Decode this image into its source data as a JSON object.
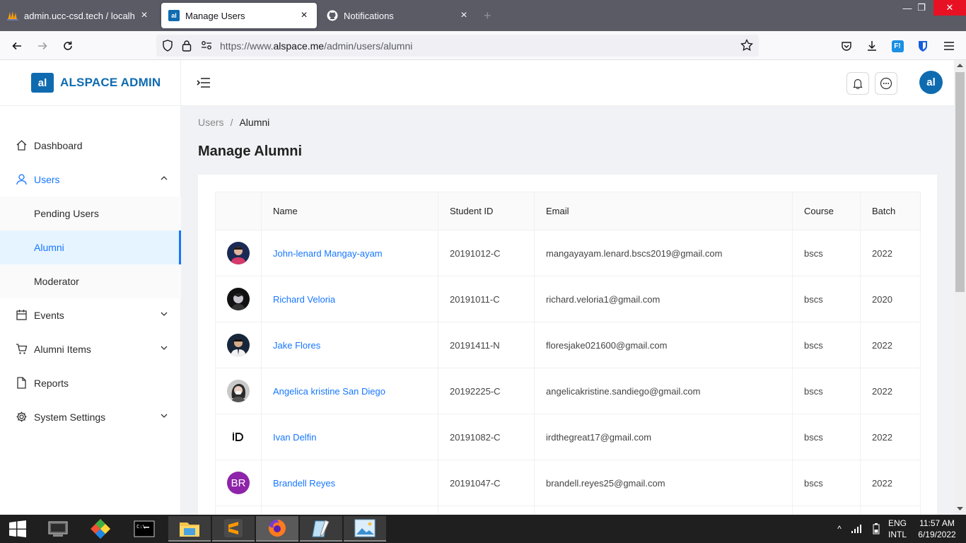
{
  "browser": {
    "tabs": [
      {
        "title": "admin.ucc-csd.tech / localhost",
        "active": false
      },
      {
        "title": "Manage Users",
        "active": true
      },
      {
        "title": "Notifications",
        "active": false
      }
    ],
    "url_prefix": "https://www.",
    "url_domain": "alspace.me",
    "url_path": "/admin/users/alumni"
  },
  "app": {
    "logo_text": "al",
    "brand": "ALSPACE ADMIN",
    "avatar_text": "al",
    "accent": "#1677ff",
    "brand_color": "#0f6bb0"
  },
  "sidebar": {
    "items": [
      {
        "label": "Dashboard",
        "icon": "home-icon"
      },
      {
        "label": "Users",
        "icon": "user-icon"
      },
      {
        "label": "Pending Users"
      },
      {
        "label": "Alumni"
      },
      {
        "label": "Moderator"
      },
      {
        "label": "Events",
        "icon": "calendar-icon"
      },
      {
        "label": "Alumni Items",
        "icon": "cart-icon"
      },
      {
        "label": "Reports",
        "icon": "file-icon"
      },
      {
        "label": "System Settings",
        "icon": "gear-icon"
      }
    ]
  },
  "breadcrumb": {
    "parent": "Users",
    "separator": "/",
    "current": "Alumni"
  },
  "page_title": "Manage Alumni",
  "table": {
    "headers": [
      "",
      "Name",
      "Student ID",
      "Email",
      "Course",
      "Batch"
    ],
    "rows": [
      {
        "name": "John-lenard Mangay-ayam",
        "student_id": "20191012-C",
        "email": "mangayayam.lenard.bscs2019@gmail.com",
        "course": "bscs",
        "batch": "2022"
      },
      {
        "name": "Richard Veloria",
        "student_id": "20191011-C",
        "email": "richard.veloria1@gmail.com",
        "course": "bscs",
        "batch": "2020"
      },
      {
        "name": "Jake Flores",
        "student_id": "20191411-N",
        "email": "floresjake021600@gmail.com",
        "course": "bscs",
        "batch": "2022"
      },
      {
        "name": "Angelica kristine San Diego",
        "student_id": "20192225-C",
        "email": "angelicakristine.sandiego@gmail.com",
        "course": "bscs",
        "batch": "2022"
      },
      {
        "name": "Ivan Delfin",
        "student_id": "20191082-C",
        "email": "irdthegreat17@gmail.com",
        "course": "bscs",
        "batch": "2022"
      },
      {
        "name": "Brandell Reyes",
        "student_id": "20191047-C",
        "email": "brandell.reyes25@gmail.com",
        "course": "bscs",
        "batch": "2022",
        "avatar_initials": "BR"
      }
    ]
  },
  "taskbar": {
    "lang_1": "ENG",
    "lang_2": "INTL",
    "time": "11:57 AM",
    "date": "6/19/2022"
  }
}
